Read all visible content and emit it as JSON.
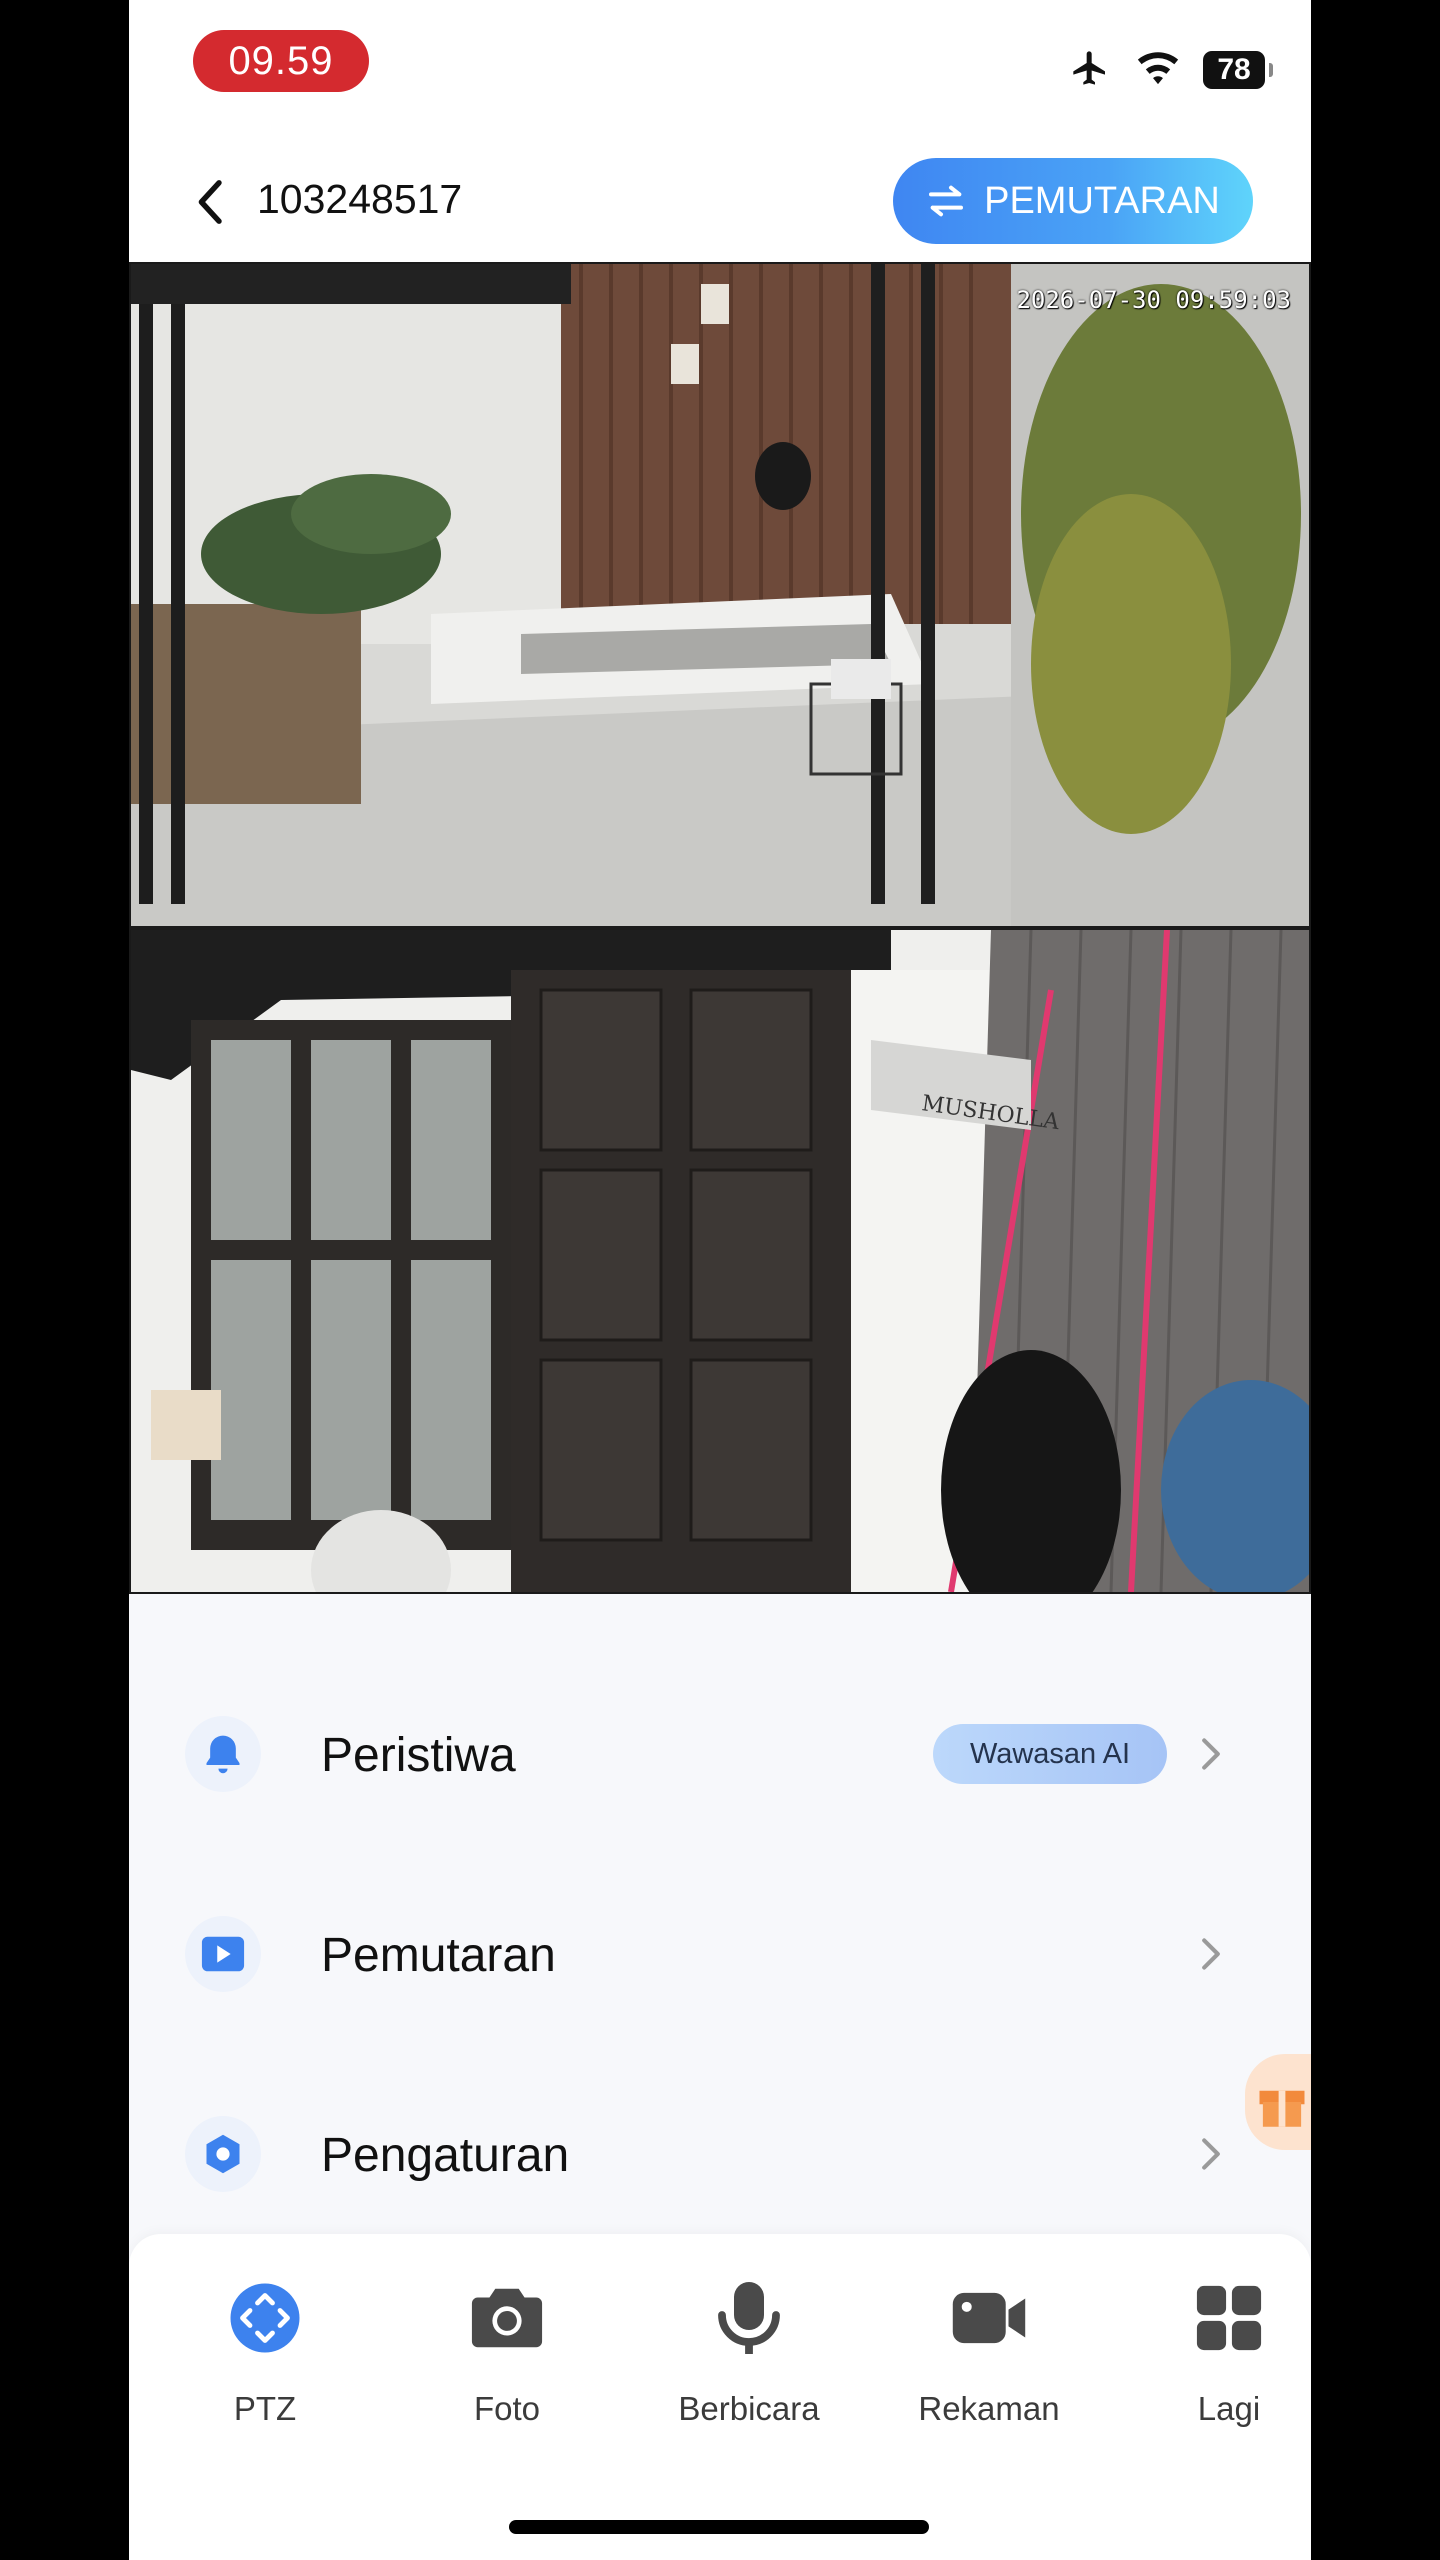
{
  "status_bar": {
    "time": "09.59",
    "battery": "78",
    "icons": [
      "airplane-icon",
      "wifi-icon",
      "battery-icon"
    ]
  },
  "header": {
    "back_icon": "chevron-left-icon",
    "device_id": "103248517",
    "playback_button": "PEMUTARAN",
    "playback_icon": "swap-arrows-icon",
    "accent": "#3f86f2"
  },
  "video": {
    "timestamp": "2026-07-30 09:59:03",
    "feeds": [
      "camera-feed-patio",
      "camera-feed-doorway"
    ],
    "sign_text": "MUSHOLLA"
  },
  "menu": {
    "items": [
      {
        "label": "Peristiwa",
        "icon": "bell-icon",
        "badge": "Wawasan AI"
      },
      {
        "label": "Pemutaran",
        "icon": "play-icon"
      },
      {
        "label": "Pengaturan",
        "icon": "settings-icon"
      }
    ]
  },
  "toolbar": {
    "items": [
      {
        "label": "PTZ",
        "icon": "ptz-joystick-icon",
        "active": true
      },
      {
        "label": "Foto",
        "icon": "camera-icon"
      },
      {
        "label": "Berbicara",
        "icon": "microphone-icon"
      },
      {
        "label": "Rekaman",
        "icon": "video-camera-icon"
      },
      {
        "label": "Lagi",
        "icon": "grid-icon"
      }
    ]
  },
  "colors": {
    "status_time_bg": "#d42a2f",
    "icon_blue": "#3d82ee",
    "badge_bg": "#bcd8fb"
  }
}
